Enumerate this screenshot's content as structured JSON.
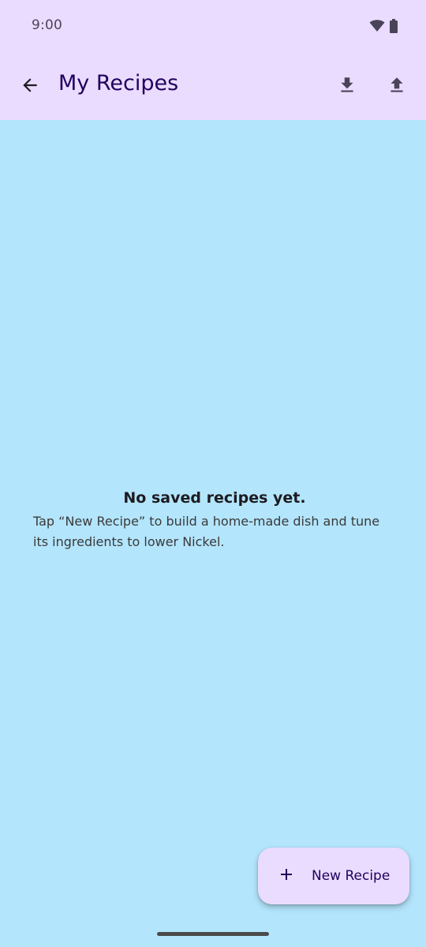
{
  "status_bar": {
    "time": "9:00",
    "icons": [
      "wifi-icon",
      "battery-icon"
    ]
  },
  "app_bar": {
    "title": "My Recipes",
    "back_icon": "arrow-back-icon",
    "actions": [
      "download-icon",
      "upload-icon"
    ]
  },
  "empty_state": {
    "title": "No saved recipes yet.",
    "message": "Tap “New Recipe” to build a home-made dish and tune its ingredients to lower Nickel."
  },
  "fab": {
    "icon": "plus-icon",
    "label": "New Recipe"
  },
  "colors": {
    "app_bar": "#eadcff",
    "background": "#b3e5fc",
    "primary_text": "#21005d"
  }
}
